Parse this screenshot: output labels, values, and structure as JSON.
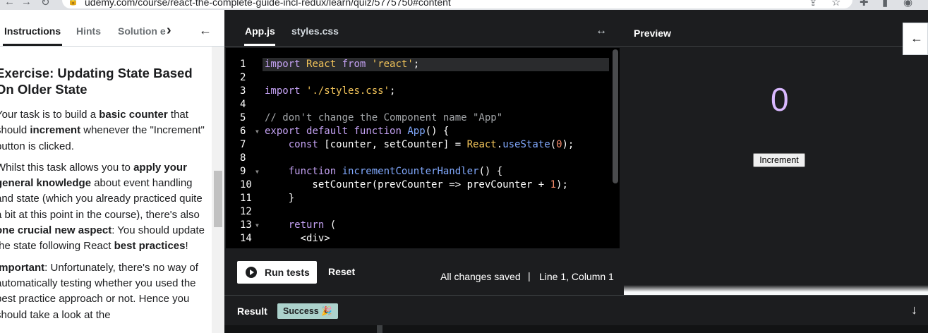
{
  "browser": {
    "url": "udemy.com/course/react-the-complete-guide-incl-redux/learn/quiz/5775750#content"
  },
  "left": {
    "tabs": [
      "Instructions",
      "Hints",
      "Solution e"
    ],
    "title": "Exercise: Updating State Based On Older State",
    "paragraphs": [
      "Your task is to build a basic counter that should increment whenever the \"Increment\" button is clicked.",
      "Whilst this task allows you to apply your general knowledge about event handling and state (which you already practiced quite a bit at this point in the course), there's also one crucial new aspect: You should update the state following React best practices!",
      "Important: Unfortunately, there's no way of automatically testing whether you used the best practice approach or not. Hence you should take a look at the"
    ]
  },
  "editor": {
    "tabs": [
      "App.js",
      "styles.css"
    ],
    "line_numbers": [
      "1",
      "2",
      "3",
      "4",
      "5",
      "6",
      "7",
      "8",
      "9",
      "10",
      "11",
      "12",
      "13",
      "14"
    ],
    "code_lines": [
      "import React from 'react';",
      "",
      "import './styles.css';",
      "",
      "// don't change the Component name \"App\"",
      "export default function App() {",
      "    const [counter, setCounter] = React.useState(0);",
      "",
      "    function incrementCounterHandler() {",
      "        setCounter(prevCounter => prevCounter + 1);",
      "    }",
      "",
      "    return (",
      "      <div>"
    ],
    "run_label": "Run tests",
    "reset_label": "Reset",
    "status_saved": "All changes saved",
    "status_sep": "|",
    "status_pos": "Line 1, Column 1"
  },
  "preview": {
    "title": "Preview",
    "counter": "0",
    "button_label": "Increment"
  },
  "result": {
    "title": "Result",
    "badge": "Success 🎉"
  }
}
